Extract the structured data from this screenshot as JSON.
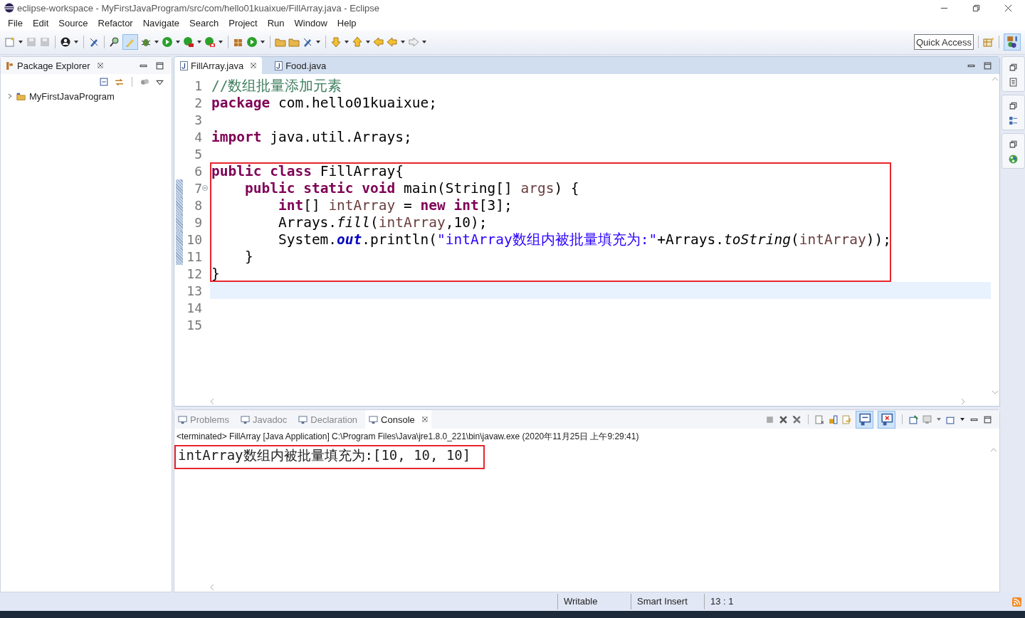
{
  "window": {
    "title": "eclipse-workspace - MyFirstJavaProgram/src/com/hello01kuaixue/FillArray.java - Eclipse"
  },
  "menu": [
    "File",
    "Edit",
    "Source",
    "Refactor",
    "Navigate",
    "Search",
    "Project",
    "Run",
    "Window",
    "Help"
  ],
  "main_toolbar": {
    "toggle_pressed": true,
    "quick_access": {
      "placeholder": "Quick Access"
    }
  },
  "package_explorer": {
    "title": "Package Explorer",
    "tree": [
      {
        "label": "MyFirstJavaProgram",
        "expanded": false
      }
    ]
  },
  "editor": {
    "tabs": [
      {
        "label": "FillArray.java",
        "selected": true
      },
      {
        "label": "Food.java",
        "selected": false
      }
    ],
    "lines": [
      {
        "number": "1",
        "tokens": [
          {
            "kind": "comment",
            "text": "//数组批量添加元素"
          }
        ]
      },
      {
        "number": "2",
        "tokens": [
          {
            "kind": "keyword",
            "text": "package"
          },
          {
            "kind": "plain",
            "text": " com.hello01kuaixue;"
          }
        ]
      },
      {
        "number": "3"
      },
      {
        "number": "4",
        "tokens": [
          {
            "kind": "keyword",
            "text": "import"
          },
          {
            "kind": "plain",
            "text": " java.util.Arrays;"
          }
        ]
      },
      {
        "number": "5"
      },
      {
        "number": "6",
        "boxed": true,
        "tokens": [
          {
            "kind": "keyword",
            "text": "public"
          },
          {
            "kind": "keyword",
            "text": " class"
          },
          {
            "kind": "plain",
            "text": " FillArray{"
          }
        ]
      },
      {
        "number": "7",
        "boxed": true,
        "changed": true,
        "foldable": true,
        "tokens": [
          {
            "kind": "keyword",
            "text": "    public"
          },
          {
            "kind": "keyword",
            "text": " static"
          },
          {
            "kind": "keyword",
            "text": " void"
          },
          {
            "kind": "plain",
            "text": " main(String[] "
          },
          {
            "kind": "variable",
            "text": "args"
          },
          {
            "kind": "plain",
            "text": ") {"
          }
        ]
      },
      {
        "number": "8",
        "boxed": true,
        "changed": true,
        "tokens": [
          {
            "kind": "keyword",
            "text": "        int"
          },
          {
            "kind": "plain",
            "text": "[] "
          },
          {
            "kind": "variable",
            "text": "intArray"
          },
          {
            "kind": "plain",
            "text": " = "
          },
          {
            "kind": "keyword",
            "text": "new"
          },
          {
            "kind": "keyword",
            "text": " int"
          },
          {
            "kind": "plain",
            "text": "[3];"
          }
        ]
      },
      {
        "number": "9",
        "boxed": true,
        "changed": true,
        "tokens": [
          {
            "kind": "plain",
            "text": "        Arrays."
          },
          {
            "kind": "static_method",
            "text": "fill"
          },
          {
            "kind": "plain",
            "text": "("
          },
          {
            "kind": "variable",
            "text": "intArray"
          },
          {
            "kind": "plain",
            "text": ",10);"
          }
        ]
      },
      {
        "number": "10",
        "boxed": true,
        "changed": true,
        "tokens": [
          {
            "kind": "plain",
            "text": "        System."
          },
          {
            "kind": "static_field",
            "text": "out"
          },
          {
            "kind": "plain",
            "text": ".println("
          },
          {
            "kind": "string",
            "text": "\"intArray数组内被批量填充为:\""
          },
          {
            "kind": "plain",
            "text": "+Arrays."
          },
          {
            "kind": "static_method",
            "text": "toString"
          },
          {
            "kind": "plain",
            "text": "("
          },
          {
            "kind": "variable",
            "text": "intArray"
          },
          {
            "kind": "plain",
            "text": "));"
          }
        ]
      },
      {
        "number": "11",
        "boxed": true,
        "changed": true,
        "tokens": [
          {
            "kind": "plain",
            "text": "    }"
          }
        ]
      },
      {
        "number": "12",
        "boxed": true,
        "tokens": [
          {
            "kind": "plain",
            "text": "}"
          }
        ]
      },
      {
        "number": "13",
        "current": true
      },
      {
        "number": "14"
      },
      {
        "number": "15"
      }
    ]
  },
  "console": {
    "tabs": [
      {
        "label": "Problems",
        "selected": false
      },
      {
        "label": "Javadoc",
        "selected": false
      },
      {
        "label": "Declaration",
        "selected": false
      },
      {
        "label": "Console",
        "selected": true
      }
    ],
    "toolbar": {
      "stdout_toggle_pressed": true,
      "stderr_toggle_pressed": true
    },
    "header": "<terminated> FillArray [Java Application] C:\\Program Files\\Java\\jre1.8.0_221\\bin\\javaw.exe (2020年11月25日 上午9:29:41)",
    "output": [
      {
        "text": "intArray数组内被批量填充为:[10, 10, 10]",
        "boxed": true
      }
    ]
  },
  "status_bar": [
    "Writable",
    "Smart Insert",
    "13 : 1"
  ]
}
